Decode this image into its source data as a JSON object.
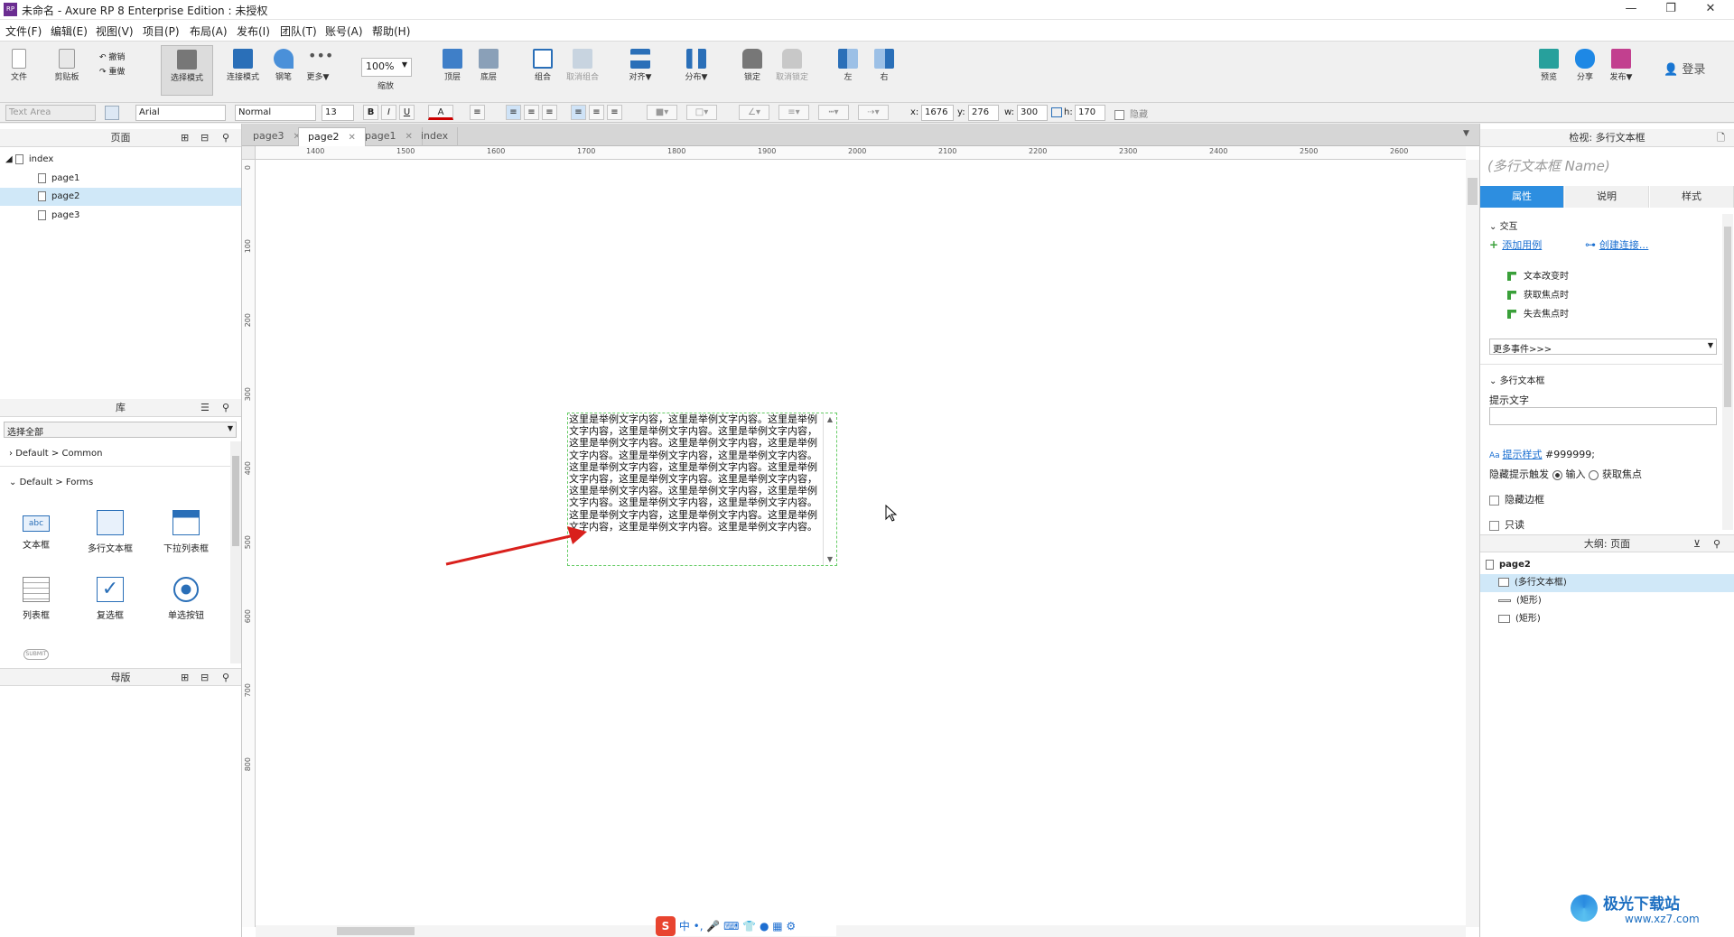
{
  "window": {
    "title": "未命名 - Axure RP 8 Enterprise Edition : 未授权",
    "logo": "RP"
  },
  "menu": [
    "文件(F)",
    "编辑(E)",
    "视图(V)",
    "项目(P)",
    "布局(A)",
    "发布(I)",
    "团队(T)",
    "账号(A)",
    "帮助(H)"
  ],
  "toolbar": {
    "file": "文件",
    "clipboard": "剪贴板",
    "undo": "撤销",
    "redo": "重做",
    "select_mode": "选择模式",
    "connect_mode": "连接模式",
    "pen": "钢笔",
    "more": "更多▼",
    "zoom_value": "100%",
    "zoom_label": "缩放",
    "top": "顶层",
    "bottom": "底层",
    "group": "组合",
    "ungroup": "取消组合",
    "align": "对齐▼",
    "distribute": "分布▼",
    "lock": "锁定",
    "unlock": "取消锁定",
    "left": "左",
    "right": "右",
    "preview": "预览",
    "share": "分享",
    "publish": "发布▼",
    "login": "登录"
  },
  "format": {
    "widget_type": "Text Area",
    "font": "Arial",
    "style": "Normal",
    "size": "13",
    "bold": "B",
    "italic": "I",
    "underline": "U",
    "color_btn": "A",
    "x_label": "x:",
    "x": "1676",
    "y_label": "y:",
    "y": "276",
    "w_label": "w:",
    "w": "300",
    "h_label": "h:",
    "h": "170",
    "hidden": "隐藏"
  },
  "pages_panel": {
    "title": "页面",
    "items": [
      {
        "label": "index",
        "level": 0,
        "selected": false
      },
      {
        "label": "page1",
        "level": 1,
        "selected": false
      },
      {
        "label": "page2",
        "level": 1,
        "selected": true
      },
      {
        "label": "page3",
        "level": 1,
        "selected": false
      }
    ]
  },
  "library_panel": {
    "title": "库",
    "select_value": "选择全部",
    "groups": [
      "Default > Common",
      "Default > Forms"
    ],
    "widgets": [
      {
        "label": "文本框",
        "icon": "text-field-icon"
      },
      {
        "label": "多行文本框",
        "icon": "text-area-icon"
      },
      {
        "label": "下拉列表框",
        "icon": "droplist-icon"
      },
      {
        "label": "列表框",
        "icon": "listbox-icon"
      },
      {
        "label": "复选框",
        "icon": "checkbox-icon"
      },
      {
        "label": "单选按钮",
        "icon": "radio-icon"
      }
    ],
    "partial_label": "SUBMIT"
  },
  "masters_panel": {
    "title": "母版"
  },
  "tabs": [
    {
      "label": "page3",
      "active": false
    },
    {
      "label": "page2",
      "active": true
    },
    {
      "label": "page1",
      "active": false
    },
    {
      "label": "index",
      "active": false
    }
  ],
  "ruler": {
    "h_ticks": [
      "1400",
      "1500",
      "1600",
      "1700",
      "1800",
      "1900",
      "2000",
      "2100",
      "2200",
      "2300",
      "2400",
      "2500",
      "2600"
    ],
    "v_ticks": [
      "0",
      "100",
      "200",
      "300",
      "400",
      "500",
      "600",
      "700",
      "800"
    ]
  },
  "canvas": {
    "textarea_text": "这里是举例文字内容，这里是举例文字内容。这里是举例文字内容，这里是举例文字内容。这里是举例文字内容，这里是举例文字内容。这里是举例文字内容，这里是举例文字内容。这里是举例文字内容，这里是举例文字内容。这里是举例文字内容，这里是举例文字内容。这里是举例文字内容，这里是举例文字内容。这里是举例文字内容，这里是举例文字内容。这里是举例文字内容，这里是举例文字内容。这里是举例文字内容，这里是举例文字内容。这里是举例文字内容，这里是举例文字内容。这里是举例文字内容，这里是举例文字内容。这里是举例文字内容。"
  },
  "inspector": {
    "title": "检视: 多行文本框",
    "name_placeholder": "(多行文本框 Name)",
    "tabs": [
      "属性",
      "说明",
      "样式"
    ],
    "interaction_section": "交互",
    "add_case": "添加用例",
    "create_link": "创建连接...",
    "events": [
      "文本改变时",
      "获取焦点时",
      "失去焦点时"
    ],
    "more_events": "更多事件>>>",
    "textarea_section": "多行文本框",
    "hint_label": "提示文字",
    "hint_style_link": "提示样式",
    "hint_color": "#999999;",
    "hide_hint_label": "隐藏提示触发",
    "hint_opt_input": "输入",
    "hint_opt_focus": "获取焦点",
    "hide_border": "隐藏边框",
    "readonly": "只读"
  },
  "outline": {
    "title": "大纲: 页面",
    "page": "page2",
    "items": [
      "(多行文本框)",
      "(矩形)",
      "(矩形)"
    ]
  },
  "watermark": {
    "text": "极光下载站",
    "url": "www.xz7.com"
  },
  "colors": {
    "accent": "#2d8ee0",
    "selection": "#d0e8f8",
    "arrow": "#d9201c"
  }
}
